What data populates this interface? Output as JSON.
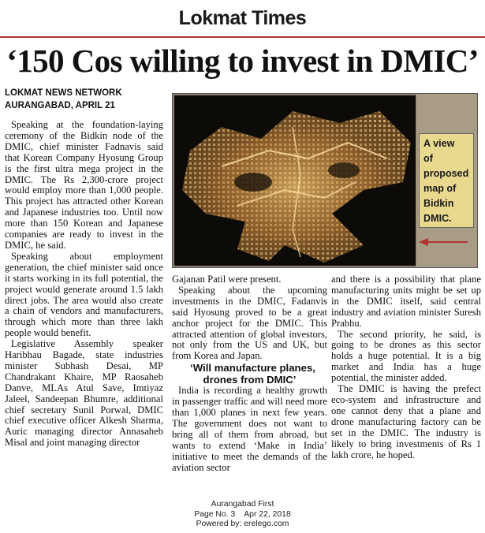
{
  "masthead": "Lokmat Times",
  "headline": "‘150 Cos willing to invest in DMIC’",
  "byline": {
    "agency": "LOKMAT NEWS NETWORK",
    "dateline": "AURANGABAD, APRIL 21"
  },
  "photo": {
    "caption_lines": [
      "A view",
      "of",
      "proposed",
      "map of",
      "Bidkin",
      "DMIC."
    ]
  },
  "col1": [
    "Speaking at the foundation-laying ceremony of the Bidkin node of the DMIC, chief minister Fadnavis said that Korean Company Hyosung Group is the first ultra mega project in the DMIC. The Rs 2,300-crore project would employ more than 1,000 people. This project has attracted other Korean and Japanese industries too. Until now more than 150 Korean and Japanese companies are ready to invest in the DMIC, he said.",
    "Speaking about employment generation, the chief minister said once it starts working in its full potential, the project would generate around 1.5 lakh direct jobs. The area would also create a chain of vendors and manufacturers, through which more than three lakh people would benefit.",
    "Legislative Assembly speaker Haribhau Bagade, state industries minister Subhash Desai, MP Chandrakant Khaire, MP Raosaheb Danve, MLAs Atul Save, Imtiyaz Jaleel, Sandeepan Bhumre, additional chief secretary Sunil Porwal, DMIC chief executive officer Alkesh Sharma, Auric managing director Annasaheb Misal and joint managing director"
  ],
  "col2": {
    "continuation": "Gajanan Patil were present.",
    "p1": "Speaking about the upcoming investments in the DMIC, Fadanvis said Hyosung proved to be a great anchor project for the DMIC. This attracted attention of global investors, not only from the US and UK, but from Korea and Japan.",
    "subhead": "‘Will manufacture planes, drones from DMIC’",
    "p2": "India is recording a healthy growth in passenger traffic and will need more than 1,000 planes in next few years. The government does not want to bring all of them from abroad, but wants to extend ‘Make in India’ initiative to meet the demands of the aviation sector"
  },
  "col3": [
    "and there is a possibility that plane manufacturing units might be set up in the DMIC itself, said central industry and aviation minister Suresh Prabhu.",
    "The second priority, he said, is going to be drones as this sector holds a huge potential. It is a big market and India has a huge potential, the minister added.",
    "The DMIC is having the prefect eco-system and infrastructure and one cannot deny that a plane and drone manufacturing factory can be set in the DMIC. The industry is likely to bring investments of Rs 1 lakh crore, he hoped."
  ],
  "footer": {
    "edition": "Aurangabad First",
    "page": "Page No. 3    Apr 22, 2018",
    "powered": "Powered by: erelego.com"
  },
  "colors": {
    "rule": "#b0362f",
    "caption_bg": "#e8d98f",
    "arrow": "#b0362f"
  }
}
